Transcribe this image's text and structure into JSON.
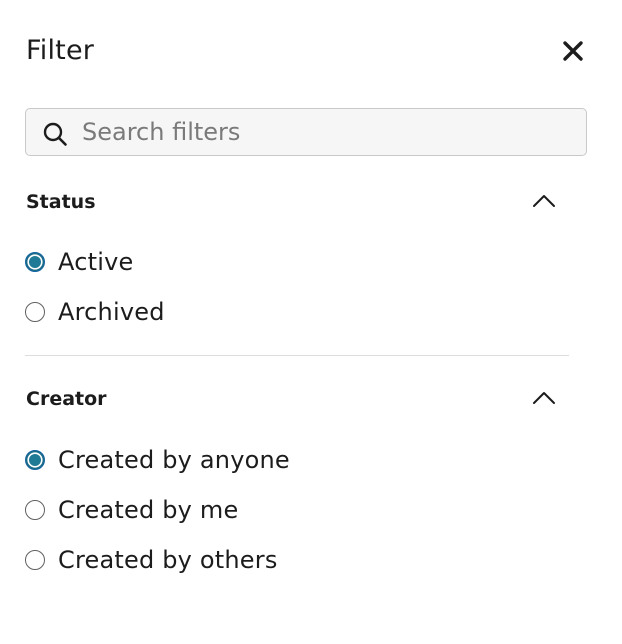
{
  "header": {
    "title": "Filter"
  },
  "search": {
    "placeholder": "Search filters",
    "value": ""
  },
  "sections": {
    "status": {
      "title": "Status",
      "expanded": true,
      "options": [
        {
          "label": "Active",
          "checked": true
        },
        {
          "label": "Archived",
          "checked": false
        }
      ]
    },
    "creator": {
      "title": "Creator",
      "expanded": true,
      "options": [
        {
          "label": "Created by anyone",
          "checked": true
        },
        {
          "label": "Created by me",
          "checked": false
        },
        {
          "label": "Created by others",
          "checked": false
        }
      ]
    }
  },
  "icons": {
    "close": "close-icon",
    "search": "search-icon",
    "chevron": "chevron-up-icon"
  },
  "colors": {
    "text": "#1d1c1d",
    "radio_checked": "#1d6c86",
    "search_bg": "#f6f6f6",
    "border": "#c9c9c9"
  }
}
